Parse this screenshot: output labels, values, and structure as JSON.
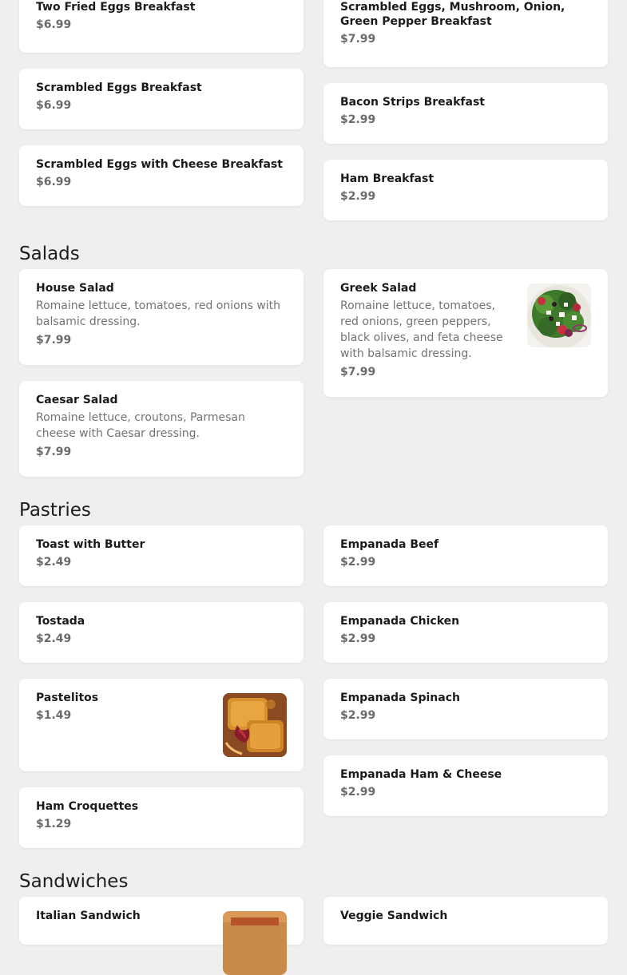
{
  "breakfast": {
    "left": [
      {
        "name": "Two Fried Eggs Breakfast",
        "price": "$6.99"
      },
      {
        "name": "Scrambled Eggs Breakfast",
        "price": "$6.99"
      },
      {
        "name": "Scrambled Eggs with Cheese Breakfast",
        "price": "$6.99"
      }
    ],
    "right": [
      {
        "name": "Scrambled Eggs, Mushroom, Onion, Green Pepper Breakfast",
        "price": "$7.99"
      },
      {
        "name": "Bacon Strips Breakfast",
        "price": "$2.99"
      },
      {
        "name": "Ham Breakfast",
        "price": "$2.99"
      }
    ]
  },
  "salads": {
    "title": "Salads",
    "left": [
      {
        "name": "House Salad",
        "desc": "Romaine lettuce, tomatoes, red onions with balsamic dressing.",
        "price": "$7.99"
      },
      {
        "name": "Caesar Salad",
        "desc": "Romaine lettuce, croutons, Parmesan cheese with Caesar dressing.",
        "price": "$7.99"
      }
    ],
    "right": [
      {
        "name": "Greek Salad",
        "desc": "Romaine lettuce, tomatoes, red onions, green peppers, black olives, and feta cheese with balsamic dressing.",
        "price": "$7.99",
        "image": "greek-salad-photo"
      }
    ]
  },
  "pastries": {
    "title": "Pastries",
    "left": [
      {
        "name": "Toast with Butter",
        "price": "$2.49"
      },
      {
        "name": "Tostada",
        "price": "$2.49"
      },
      {
        "name": "Pastelitos",
        "price": "$1.49",
        "image": "pastelitos-photo"
      },
      {
        "name": "Ham Croquettes",
        "price": "$1.29"
      }
    ],
    "right": [
      {
        "name": "Empanada Beef",
        "price": "$2.99"
      },
      {
        "name": "Empanada Chicken",
        "price": "$2.99"
      },
      {
        "name": "Empanada Spinach",
        "price": "$2.99"
      },
      {
        "name": "Empanada Ham & Cheese",
        "price": "$2.99"
      }
    ]
  },
  "sandwiches": {
    "title": "Sandwiches",
    "left": [
      {
        "name": "Italian Sandwich",
        "image": "italian-sandwich-photo"
      }
    ],
    "right": [
      {
        "name": "Veggie Sandwich"
      }
    ]
  }
}
